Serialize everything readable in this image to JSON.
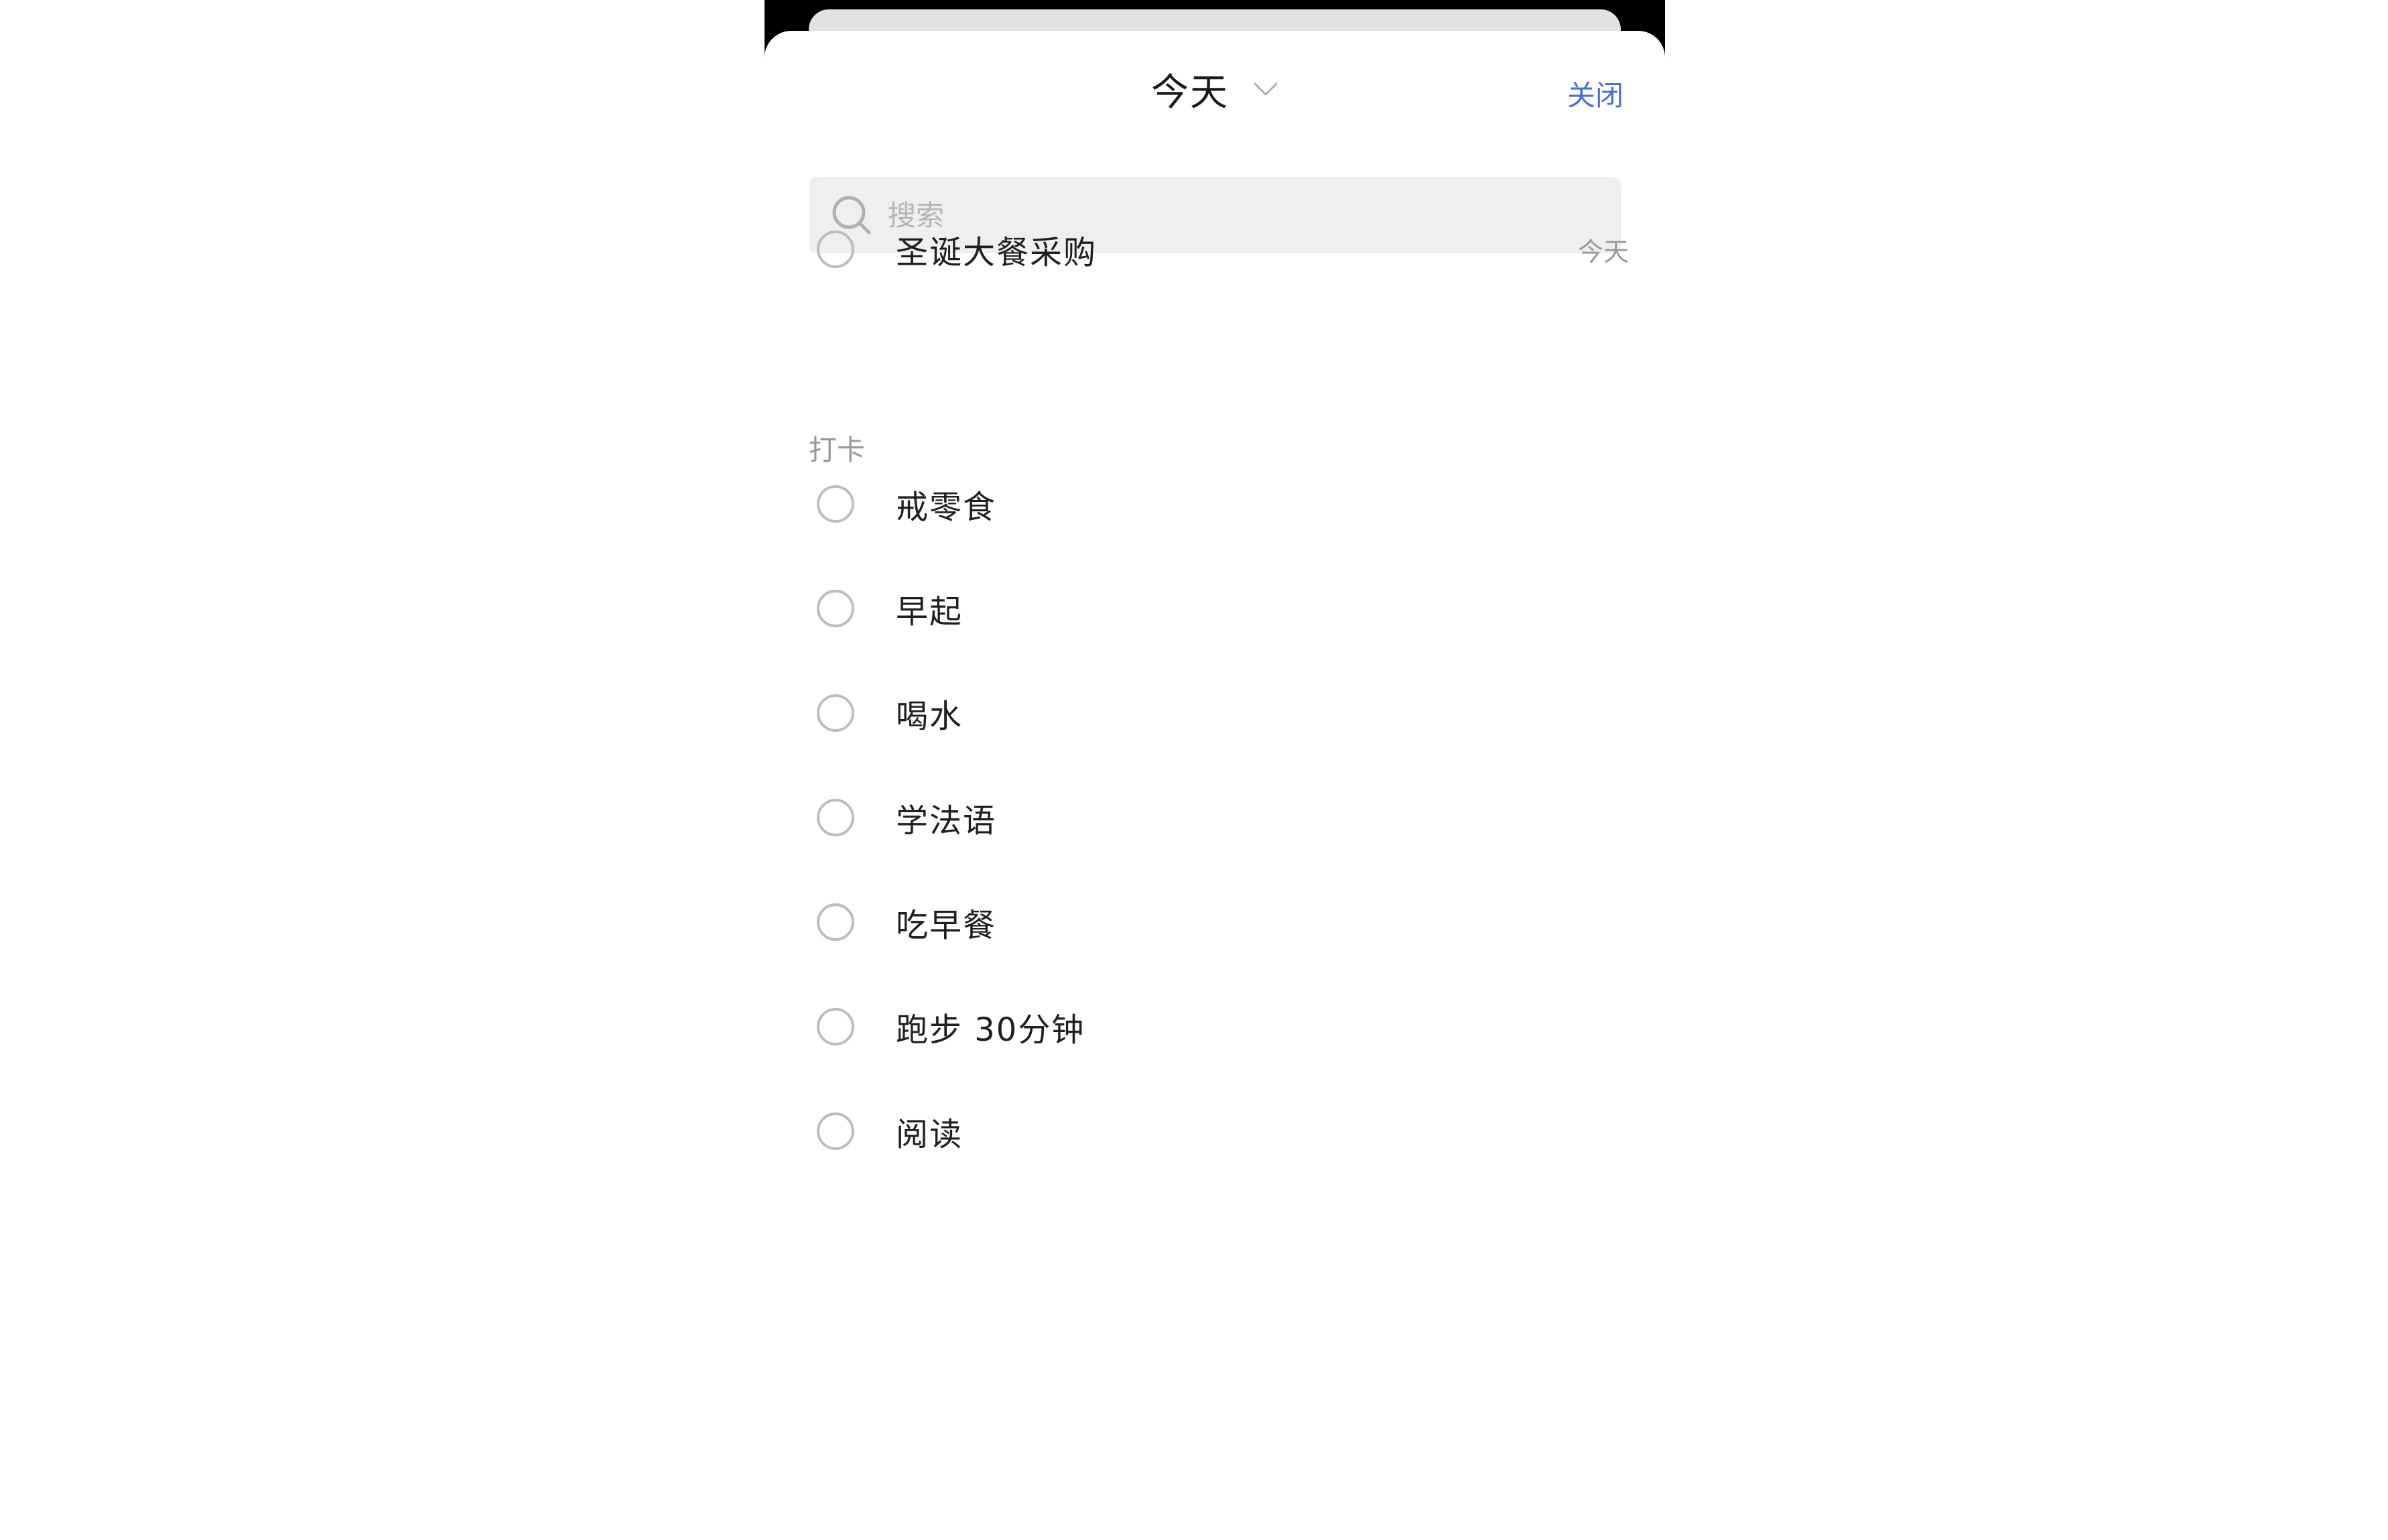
{
  "header": {
    "title": "今天",
    "close_label": "关闭"
  },
  "search": {
    "placeholder": "搜索",
    "value": ""
  },
  "tasks": [
    {
      "label": "圣诞大餐采购",
      "date": "今天"
    }
  ],
  "section": {
    "label": "打卡"
  },
  "habits": [
    {
      "label": "戒零食"
    },
    {
      "label": "早起"
    },
    {
      "label": "喝水"
    },
    {
      "label": "学法语"
    },
    {
      "label": "吃早餐"
    },
    {
      "label": "跑步 30分钟"
    },
    {
      "label": "阅读"
    }
  ],
  "colors": {
    "accent": "#4a72c9",
    "muted": "#9a9a9a",
    "search_bg": "#efefef"
  },
  "icons": [
    "chevron-down-icon",
    "search-icon",
    "radio-icon"
  ]
}
